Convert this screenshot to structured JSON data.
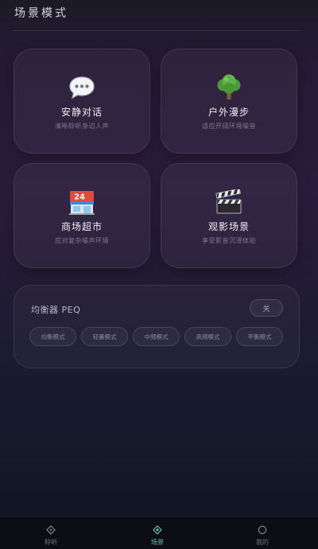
{
  "header": {
    "title": "场景模式"
  },
  "scenes": [
    {
      "name": "安静对话",
      "desc": "清晰聆听身边人声",
      "icon": "speech-bubble-icon"
    },
    {
      "name": "户外漫步",
      "desc": "适应开阔环境噪音",
      "icon": "tree-icon"
    },
    {
      "name": "商场超市",
      "desc": "应对复杂噪声环境",
      "icon": "convenience-store-icon"
    },
    {
      "name": "观影场景",
      "desc": "享受影音沉浸体验",
      "icon": "clapperboard-icon"
    }
  ],
  "equalizer": {
    "title": "均衡器 PEQ",
    "toggle_label": "关",
    "modes": [
      "均衡模式",
      "轻量模式",
      "中频模式",
      "高频模式",
      "平衡模式"
    ]
  },
  "nav": {
    "items": [
      {
        "label": "聆听",
        "icon": "diamond-outline-icon",
        "active": false
      },
      {
        "label": "场景",
        "icon": "diamond-dot-icon",
        "active": true
      },
      {
        "label": "我的",
        "icon": "circle-outline-icon",
        "active": false
      }
    ]
  },
  "colors": {
    "accent": "#64c4a6",
    "background_top": "#261a36",
    "background_bottom": "#10131f"
  }
}
